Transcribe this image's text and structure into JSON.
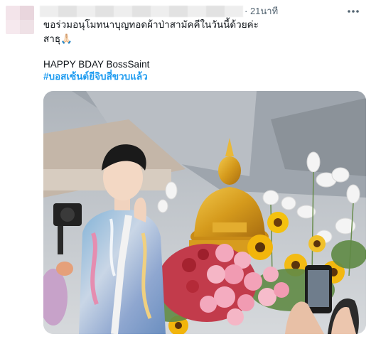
{
  "tweet": {
    "time": "· 21นาที",
    "text_line1": "ขอร่วมอนุโมทนาบุญทอดผ้าป่าสามัคคีในวันนี้ด้วยค่ะ",
    "text_line2": "สาธุ🙏🏻",
    "text_line3": "HAPPY BDAY BossSaint",
    "hashtag": "#บอสเซ้นต์ยีจิบสี่ขวบแล้ว"
  },
  "icons": {
    "more": "more-horizontal-icon"
  },
  "colors": {
    "text": "#0f1419",
    "secondary": "#536471",
    "link": "#1d9bf0"
  }
}
